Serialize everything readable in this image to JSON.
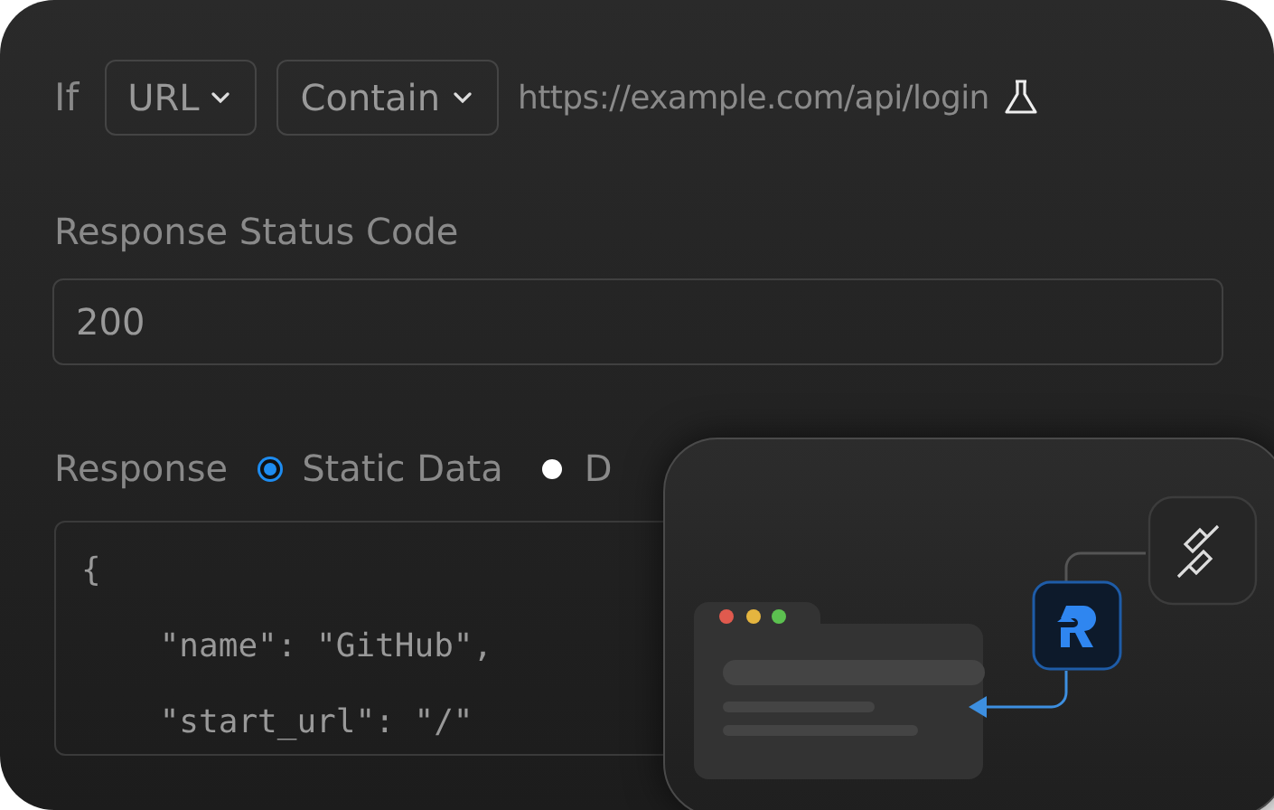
{
  "rule": {
    "prefix": "If",
    "selects": [
      {
        "label": "URL"
      },
      {
        "label": "Contain"
      }
    ],
    "value": "https://example.com/api/login"
  },
  "status_code": {
    "label": "Response Status Code",
    "value": "200"
  },
  "response": {
    "label": "Response",
    "options": [
      {
        "label": "Static Data",
        "selected": true
      },
      {
        "label": "D",
        "selected": false
      }
    ],
    "code_lines": [
      "{",
      "    \"name\": \"GitHub\",",
      "    \"start_url\": \"/\""
    ]
  }
}
